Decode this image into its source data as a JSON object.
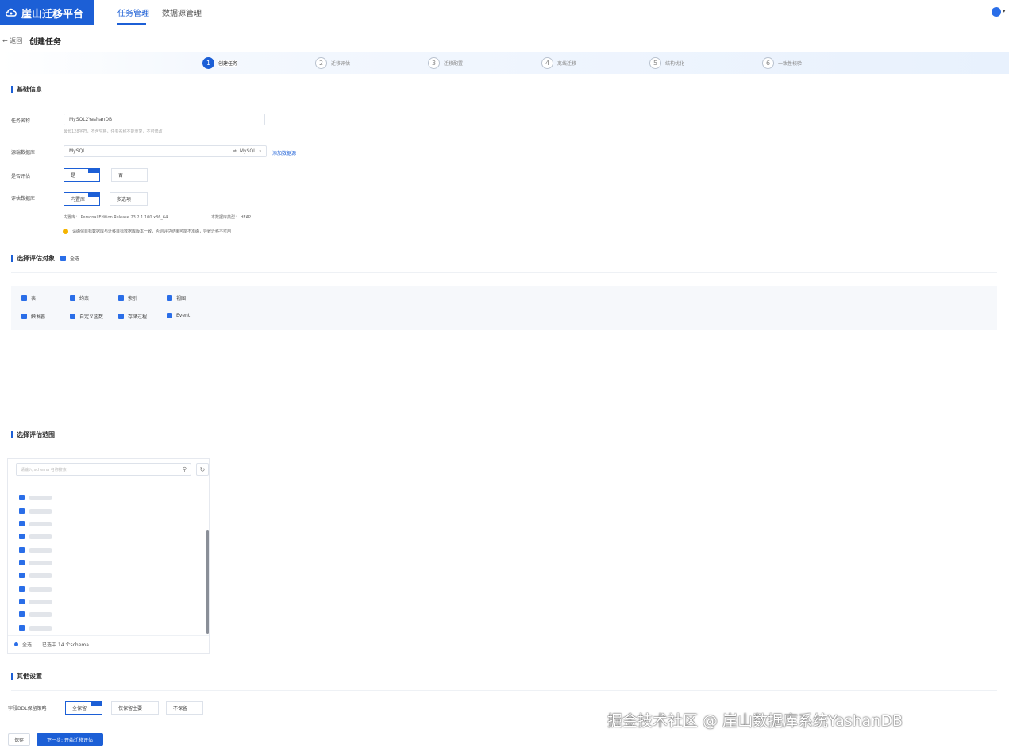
{
  "app": {
    "brand": "崖山迁移平台"
  },
  "topnav": {
    "task": "任务管理",
    "datasource": "数据源管理"
  },
  "header": {
    "back": "← 返回",
    "title": "创建任务"
  },
  "steps": [
    {
      "num": "1",
      "label": "创建任务"
    },
    {
      "num": "2",
      "label": "迁移评估"
    },
    {
      "num": "3",
      "label": "迁移配置"
    },
    {
      "num": "4",
      "label": "离线迁移"
    },
    {
      "num": "5",
      "label": "结构优化"
    },
    {
      "num": "6",
      "label": "一致性校验"
    }
  ],
  "basic": {
    "title": "基础信息",
    "task_name_label": "任务名称",
    "task_name_value": "MySQL2YashanDB",
    "task_name_hint": "最长128字符，不含空格，任务名称不能重复，不可修改",
    "source_label": "源端数据库",
    "source_value": "MySQL",
    "source_type": "MySQL",
    "add_datasource": "添加数据源",
    "eval_label": "是否评估",
    "eval_yes": "是",
    "eval_no": "否",
    "target_label": "评估数据库",
    "target_builtin": "内置库",
    "target_other": "多选项",
    "version_text": "内置库： Personal Edition Release 23.2.1.100 x86_64",
    "mode_text": "本数据库类型： HEAP",
    "warning_text": "请确保目标数据库与迁移目标数据库版本一致，否则评估结果可能不准确，导致迁移不可用"
  },
  "objects": {
    "title": "选择评估对象",
    "select_all": "全选",
    "row1": [
      "表",
      "约束",
      "索引",
      "视图"
    ],
    "row2": [
      "触发器",
      "自定义函数",
      "存储过程",
      "Event"
    ]
  },
  "range": {
    "title": "选择评估范围",
    "search_placeholder": "请输入 schema 名称搜索",
    "footer_all": "全选",
    "footer_count": "已选中 14 个schema"
  },
  "other": {
    "title": "其他设置",
    "ddl_label": "字段DDL保留策略",
    "opt_all": "全保留",
    "opt_partial": "仅保留主要",
    "opt_none": "不保留"
  },
  "buttons": {
    "save": "保存",
    "next": "下一步: 开始迁移评估"
  },
  "watermark": "掘金技术社区 @ 崖山数据库系统YashanDB",
  "colors": {
    "brand": "#1c5fd6",
    "accent": "#2a6ee8"
  }
}
